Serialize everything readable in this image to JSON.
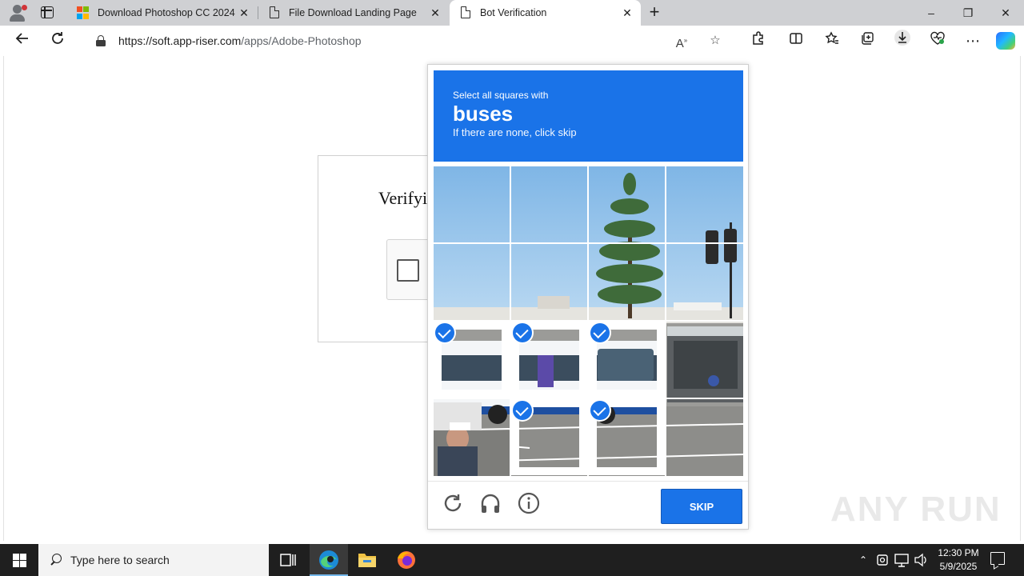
{
  "browser": {
    "tabs": [
      {
        "label": "Download Photoshop CC 2024 x",
        "icon": "microsoft-logo-icon",
        "active": false
      },
      {
        "label": "File Download Landing Page",
        "icon": "page-icon",
        "active": false
      },
      {
        "label": "Bot Verification",
        "icon": "page-icon",
        "active": true
      }
    ],
    "new_tab": "+",
    "address": {
      "url_host": "https://soft.app-riser.com",
      "url_path": "/apps/Adobe-Photoshop"
    },
    "window_controls": {
      "minimize": "–",
      "restore": "❐",
      "close": "✕"
    }
  },
  "page": {
    "verify_title": "Verifyi"
  },
  "captcha": {
    "instruction": "Select all squares with",
    "target": "buses",
    "hint": "If there are none, click skip",
    "tiles": [
      {
        "row": 0,
        "col": 0,
        "selected": false
      },
      {
        "row": 0,
        "col": 1,
        "selected": false
      },
      {
        "row": 0,
        "col": 2,
        "selected": false
      },
      {
        "row": 0,
        "col": 3,
        "selected": false
      },
      {
        "row": 1,
        "col": 0,
        "selected": false
      },
      {
        "row": 1,
        "col": 1,
        "selected": false
      },
      {
        "row": 1,
        "col": 2,
        "selected": false
      },
      {
        "row": 1,
        "col": 3,
        "selected": false
      },
      {
        "row": 2,
        "col": 0,
        "selected": true
      },
      {
        "row": 2,
        "col": 1,
        "selected": true
      },
      {
        "row": 2,
        "col": 2,
        "selected": true
      },
      {
        "row": 2,
        "col": 3,
        "selected": false
      },
      {
        "row": 3,
        "col": 0,
        "selected": false
      },
      {
        "row": 3,
        "col": 1,
        "selected": true
      },
      {
        "row": 3,
        "col": 2,
        "selected": true
      },
      {
        "row": 3,
        "col": 3,
        "selected": false
      }
    ],
    "skip_label": "SKIP",
    "accent": "#1a73e8"
  },
  "watermark": "ANY RUN",
  "taskbar": {
    "search_placeholder": "Type here to search",
    "time": "12:30 PM",
    "date": "5/9/2025"
  }
}
